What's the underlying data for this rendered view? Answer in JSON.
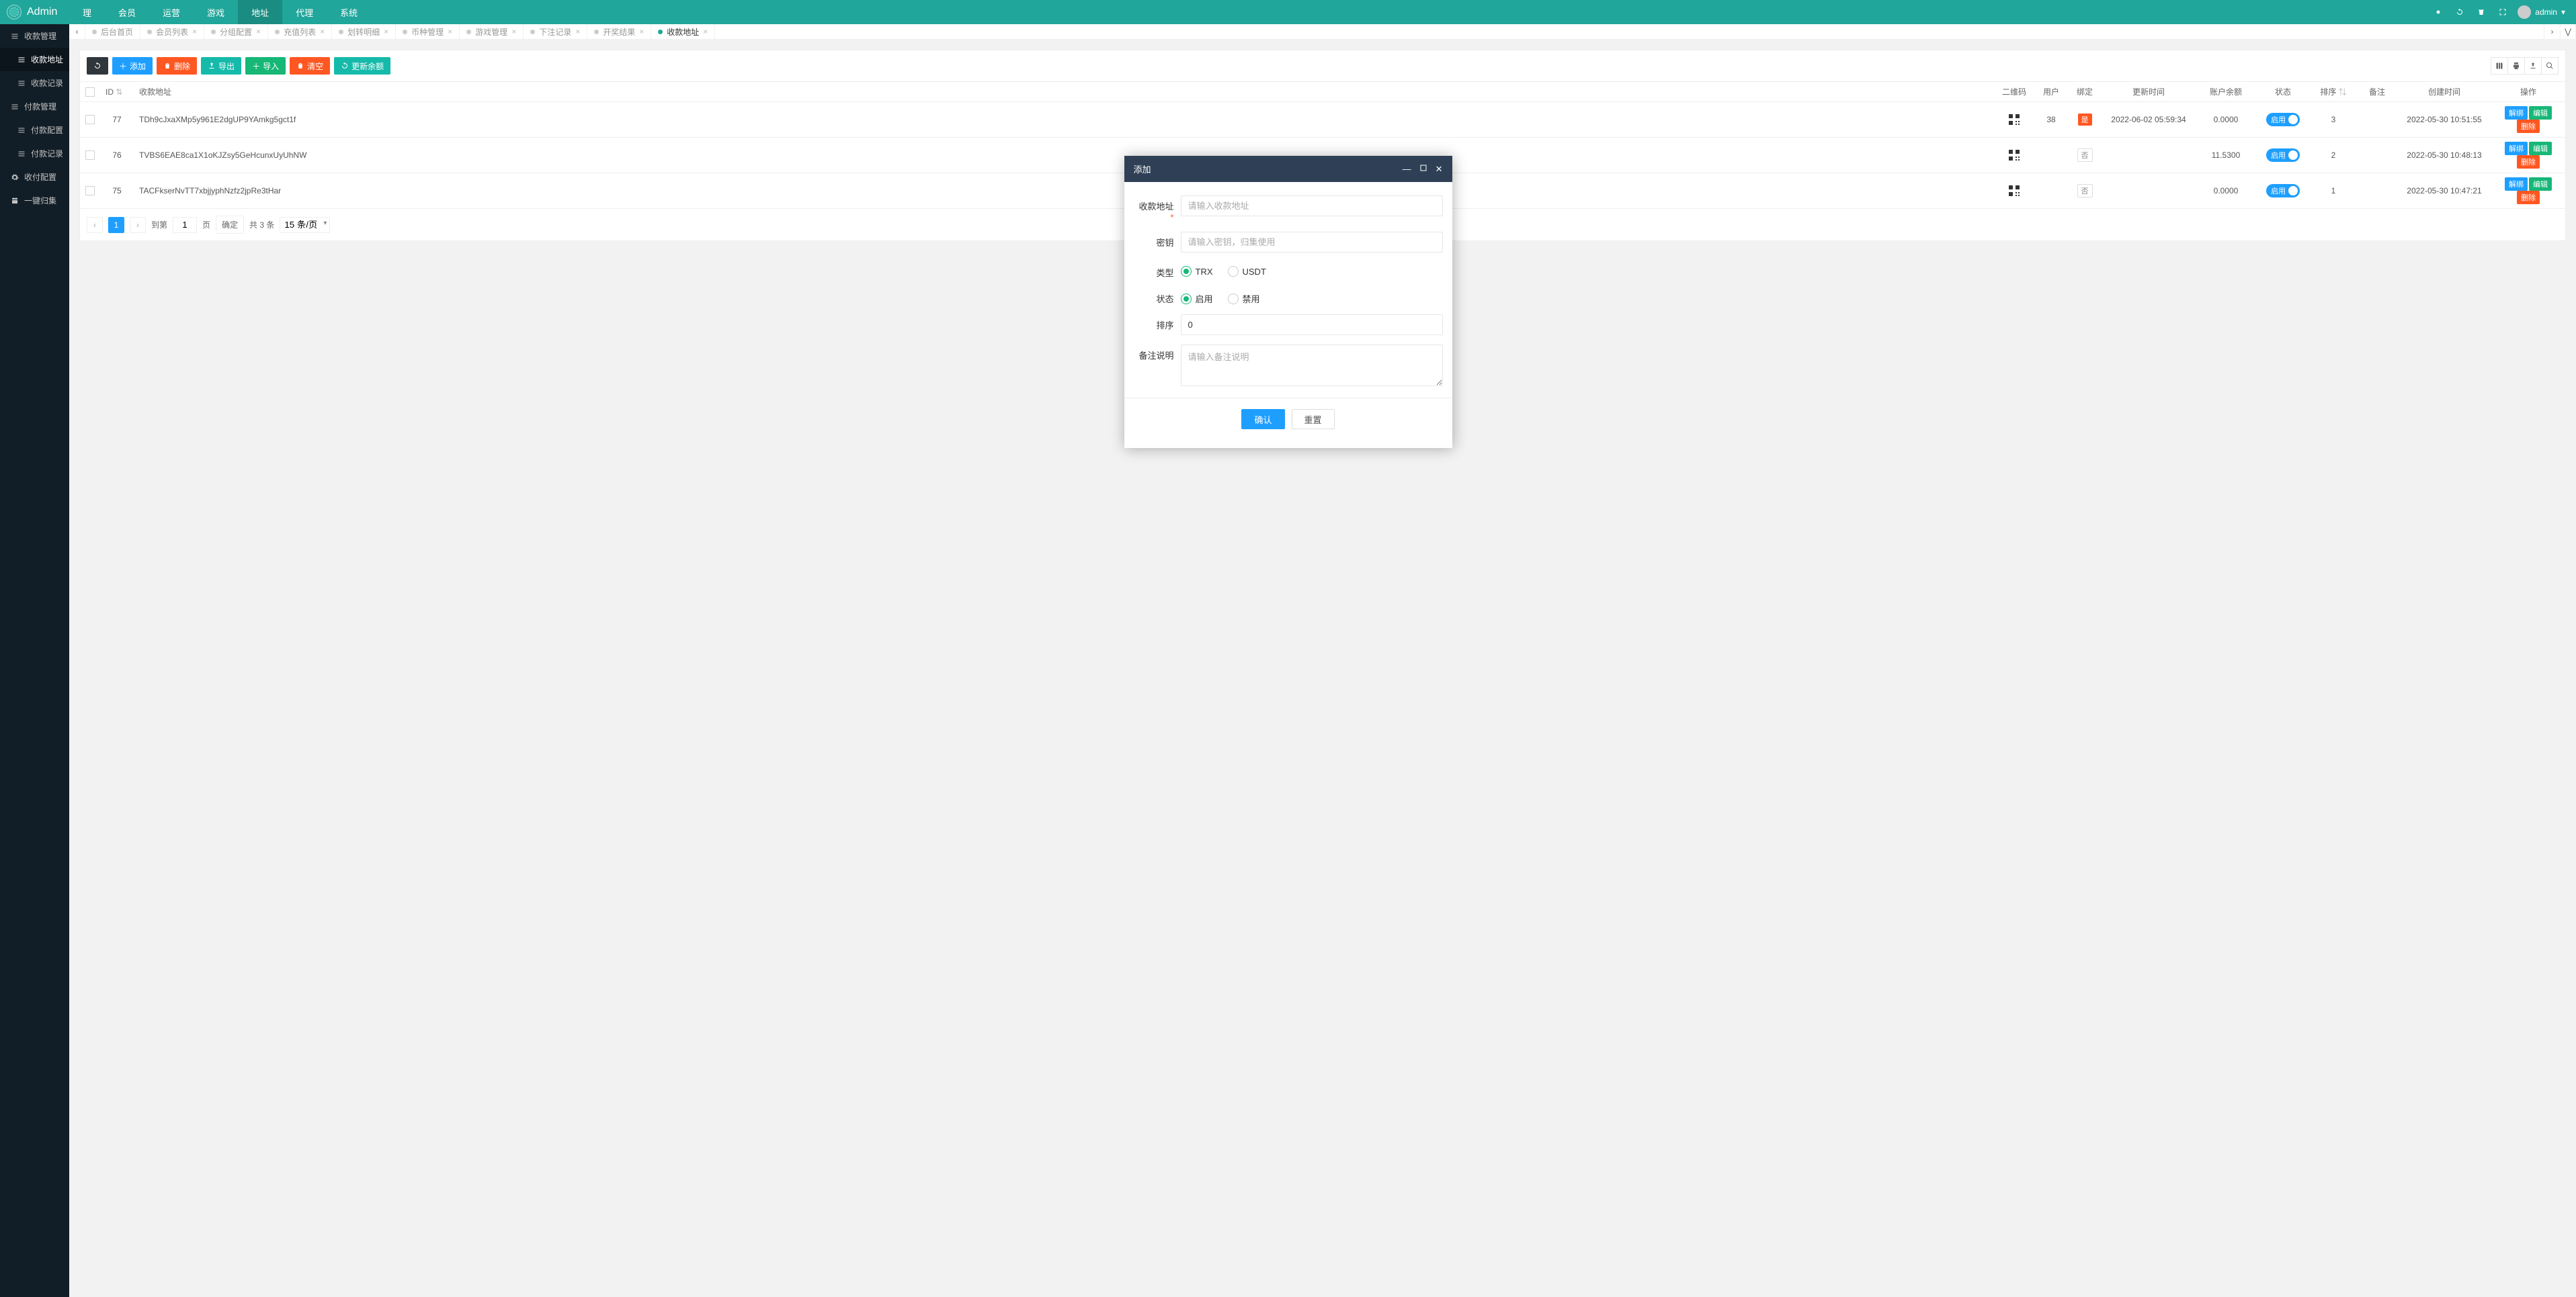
{
  "header": {
    "logo_text": "Admin",
    "user_name": "admin",
    "nav": [
      {
        "label": "理",
        "active": false
      },
      {
        "label": "会员",
        "active": false
      },
      {
        "label": "运营",
        "active": false
      },
      {
        "label": "游戏",
        "active": false
      },
      {
        "label": "地址",
        "active": true
      },
      {
        "label": "代理",
        "active": false
      },
      {
        "label": "系统",
        "active": false
      }
    ]
  },
  "sidebar": [
    {
      "label": "收款管理",
      "icon": "list",
      "level": 1
    },
    {
      "label": "收款地址",
      "icon": "list",
      "level": 2,
      "active": true
    },
    {
      "label": "收款记录",
      "icon": "list",
      "level": 2
    },
    {
      "label": "付款管理",
      "icon": "list",
      "level": 1
    },
    {
      "label": "付款配置",
      "icon": "list",
      "level": 2
    },
    {
      "label": "付款记录",
      "icon": "list",
      "level": 2
    },
    {
      "label": "收付配置",
      "icon": "gear",
      "level": 1
    },
    {
      "label": "一键归集",
      "icon": "calendar",
      "level": 1
    }
  ],
  "tabs": [
    {
      "label": "后台首页",
      "closable": false
    },
    {
      "label": "会员列表"
    },
    {
      "label": "分组配置"
    },
    {
      "label": "充值列表"
    },
    {
      "label": "划转明细"
    },
    {
      "label": "币种管理"
    },
    {
      "label": "游戏管理"
    },
    {
      "label": "下注记录"
    },
    {
      "label": "开奖结果"
    },
    {
      "label": "收款地址",
      "active": true
    }
  ],
  "toolbar": {
    "refresh": "",
    "add": "添加",
    "delete": "删除",
    "export": "导出",
    "import": "导入",
    "clear": "清空",
    "update_balance": "更新余额"
  },
  "table": {
    "headers": {
      "id": "ID",
      "address": "收款地址",
      "qr": "二维码",
      "user": "用户",
      "bind": "绑定",
      "update_time": "更新时间",
      "balance": "账户余额",
      "status": "状态",
      "sort": "排序",
      "remark": "备注",
      "create_time": "创建时间",
      "ops": "操作"
    },
    "switch_label": "启用",
    "rows": [
      {
        "id": "77",
        "address": "TDh9cJxaXMp5y961E2dgUP9YAmkg5gct1f",
        "user": "38",
        "bind": "是",
        "bind_red": true,
        "update_time": "2022-06-02 05:59:34",
        "balance": "0.0000",
        "sort": "3",
        "create_time": "2022-05-30 10:51:55"
      },
      {
        "id": "76",
        "address": "TVBS6EAE8ca1X1oKJZsy5GeHcunxUyUhNW",
        "user": "",
        "bind": "否",
        "bind_red": false,
        "update_time": "",
        "balance": "11.5300",
        "sort": "2",
        "create_time": "2022-05-30 10:48:13"
      },
      {
        "id": "75",
        "address": "TACFkserNvTT7xbjjyphNzfz2jpRe3tHar",
        "user": "",
        "bind": "否",
        "bind_red": false,
        "update_time": "",
        "balance": "0.0000",
        "sort": "1",
        "create_time": "2022-05-30 10:47:21"
      }
    ],
    "actions": {
      "a1": "解绑",
      "a2": "编辑",
      "a3": "删除"
    }
  },
  "pager": {
    "page": "1",
    "jump_label": "到第",
    "page_input": "1",
    "page_suffix": "页",
    "confirm": "确定",
    "total": "共 3 条",
    "per_page": "15 条/页"
  },
  "modal": {
    "title": "添加",
    "labels": {
      "address": "收款地址",
      "key": "密钥",
      "type": "类型",
      "status": "状态",
      "sort": "排序",
      "remark": "备注说明"
    },
    "placeholders": {
      "address": "请输入收款地址",
      "key": "请输入密钥，归集使用",
      "remark": "请输入备注说明"
    },
    "type_options": {
      "trx": "TRX",
      "usdt": "USDT"
    },
    "status_options": {
      "on": "启用",
      "off": "禁用"
    },
    "sort_value": "0",
    "buttons": {
      "ok": "确认",
      "reset": "重置"
    }
  }
}
